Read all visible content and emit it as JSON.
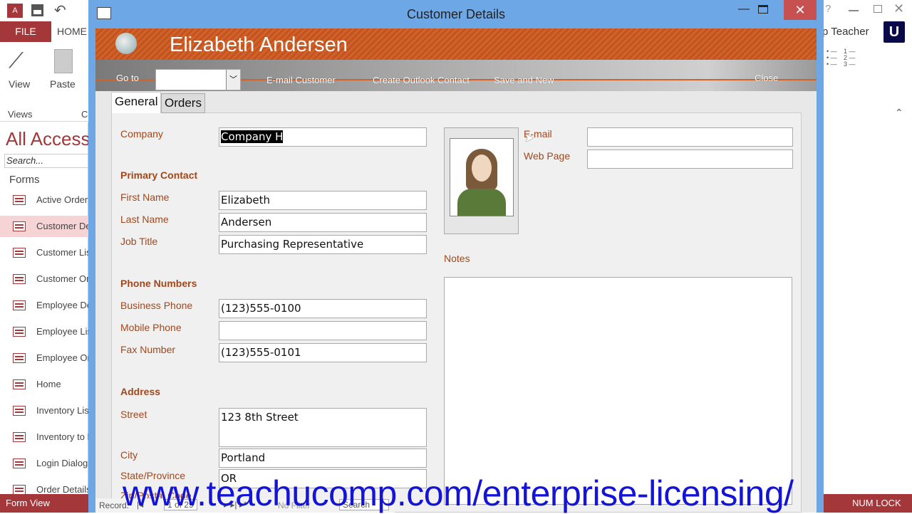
{
  "app": {
    "file_tab": "FILE",
    "home_tab": "HOME",
    "view_label": "View",
    "paste_label": "Paste",
    "views_group": "Views",
    "clipboard_group_partial": "C",
    "account": "p Teacher",
    "logo_letter": "U",
    "help": "?"
  },
  "nav": {
    "title": "All Access",
    "search_placeholder": "Search...",
    "group": "Forms",
    "items": [
      "Active Orders",
      "Customer Details",
      "Customer List",
      "Customer Orders",
      "Employee Details",
      "Employee List",
      "Employee Orders",
      "Home",
      "Inventory List",
      "Inventory to Reorder",
      "Login Dialog",
      "Order Details"
    ],
    "selected": "Customer Details"
  },
  "status": {
    "left": "Form View",
    "right": "NUM LOCK"
  },
  "window": {
    "title": "Customer Details"
  },
  "form": {
    "header_name": "Elizabeth Andersen",
    "toolbar": {
      "goto": "Go to",
      "goto_value": "",
      "email": "E-mail Customer",
      "outlook": "Create Outlook Contact",
      "save_new": "Save and New",
      "close": "Close"
    },
    "tabs": [
      "General",
      "Orders"
    ],
    "active_tab": "General",
    "labels": {
      "company": "Company",
      "primary_contact": "Primary Contact",
      "first_name": "First Name",
      "last_name": "Last Name",
      "job_title": "Job Title",
      "phone_numbers": "Phone Numbers",
      "business_phone": "Business Phone",
      "mobile_phone": "Mobile Phone",
      "fax": "Fax Number",
      "address": "Address",
      "street": "Street",
      "city": "City",
      "state": "State/Province",
      "zip": "Zip/Postal Code",
      "email": "E-mail",
      "web": "Web Page",
      "notes": "Notes"
    },
    "values": {
      "company": "Company H",
      "first_name": "Elizabeth",
      "last_name": "Andersen",
      "job_title": "Purchasing Representative",
      "business_phone": "(123)555-0100",
      "mobile_phone": "",
      "fax": "(123)555-0101",
      "street": "123 8th Street",
      "city": "Portland",
      "state": "OR",
      "email": "",
      "web": "",
      "notes": ""
    }
  },
  "record_nav": {
    "label": "Record:",
    "position": "1 of 29",
    "filter": "No Filter",
    "search": "Search"
  },
  "watermark": "www.teachucomp.com/enterprise-licensing/"
}
